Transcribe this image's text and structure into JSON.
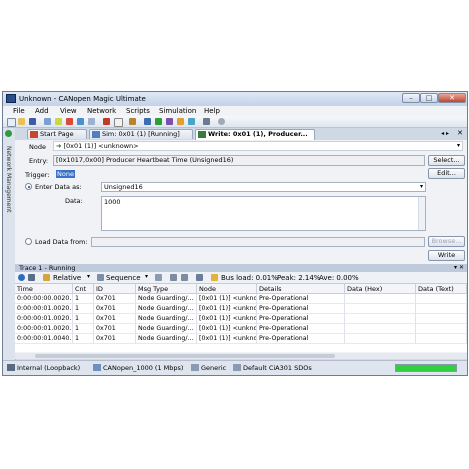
{
  "window": {
    "title": "Unknown - CANopen Magic Ultimate"
  },
  "menu": [
    "File",
    "Add",
    "View",
    "Network",
    "Scripts",
    "Simulation",
    "Help"
  ],
  "sidebar": {
    "vertical_label": "Network Management"
  },
  "tabs": [
    {
      "label": "Start Page",
      "active": false
    },
    {
      "label": "Sim: 0x01 (1) [Running]",
      "active": false
    },
    {
      "label": "Write: 0x01 (1), Producer...",
      "active": true
    }
  ],
  "form": {
    "node_label": "Node",
    "node_value": "[0x01 (1)] <unknown>",
    "entry_label": "Entry:",
    "entry_value": "[0x1017,0x00] Producer Heartbeat Time (Unsigned16)",
    "select_button": "Select...",
    "trigger_label": "Trigger:",
    "trigger_value": "None",
    "edit_button": "Edit...",
    "enter_data_label": "Enter Data as:",
    "enter_data_type": "Unsigned16",
    "data_label": "Data:",
    "data_value": "1000",
    "load_data_label": "Load Data from:",
    "load_data_value": "",
    "browse_button": "Browse...",
    "write_button": "Write"
  },
  "trace": {
    "title": "Trace 1 - Running",
    "time_mode": "Relative",
    "sort_mode": "Sequence",
    "bus_load": "Bus load: 0.01%",
    "peak": "Peak: 2.14%",
    "avg": "Ave: 0.00%",
    "columns": [
      "Time",
      "Cnt",
      "ID",
      "Msg Type",
      "Node",
      "Details",
      "Data (Hex)",
      "Data (Text)"
    ],
    "rows": [
      [
        "0:00:00:00.0020...",
        "1",
        "0x701",
        "Node Guarding/...",
        "[0x01 (1)] <unkno...",
        "Pre-Operational",
        "",
        ""
      ],
      [
        "0:00:00:01.0020...",
        "1",
        "0x701",
        "Node Guarding/...",
        "[0x01 (1)] <unkno...",
        "Pre-Operational",
        "",
        ""
      ],
      [
        "0:00:00:01.0020...",
        "1",
        "0x701",
        "Node Guarding/...",
        "[0x01 (1)] <unkno...",
        "Pre-Operational",
        "",
        ""
      ],
      [
        "0:00:00:01.0020...",
        "1",
        "0x701",
        "Node Guarding/...",
        "[0x01 (1)] <unkno...",
        "Pre-Operational",
        "",
        ""
      ],
      [
        "0:00:00:01.0040...",
        "1",
        "0x701",
        "Node Guarding/...",
        "[0x01 (1)] <unkno...",
        "Pre-Operational",
        "",
        ""
      ]
    ]
  },
  "status": {
    "interface": "Internal (Loopback)",
    "network": "CANopen_1000 (1 Mbps)",
    "profile": "Generic",
    "sdo": "Default CiA301 SDOs",
    "progress_fraction": 1.0
  },
  "colors": {
    "accent": "#2a4e8a",
    "progress": "#2fcf3f",
    "selection": "#3a72c9"
  }
}
